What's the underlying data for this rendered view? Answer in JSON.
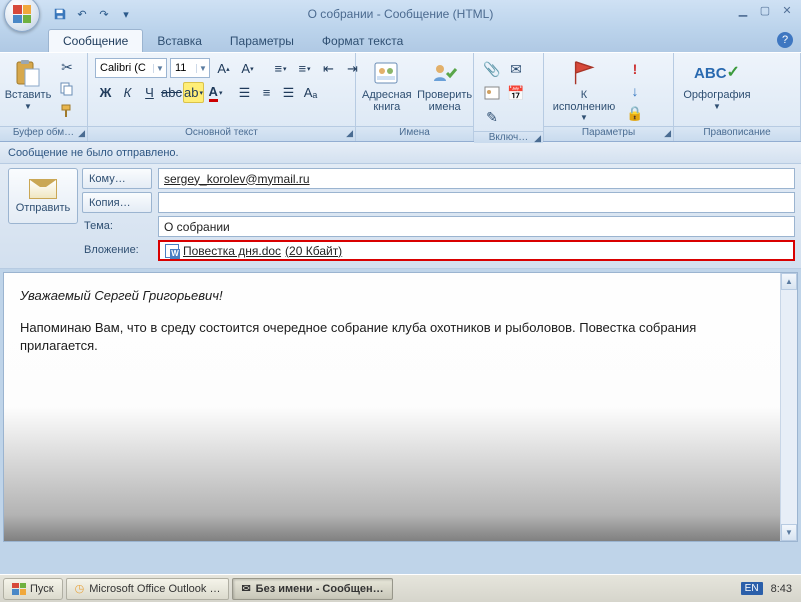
{
  "window_title": "О собрании - Сообщение (HTML)",
  "qat_dropdown": "▾",
  "tabs": {
    "t1": "Сообщение",
    "t2": "Вставка",
    "t3": "Параметры",
    "t4": "Формат текста"
  },
  "ribbon": {
    "clipboard": {
      "paste": "Вставить",
      "label": "Буфер обм…"
    },
    "font": {
      "name": "Calibri (С",
      "size": "11",
      "label": "Основной текст"
    },
    "names": {
      "addressbook": "Адресная\nкнига",
      "checknames": "Проверить\nимена",
      "label": "Имена"
    },
    "include": {
      "label": "Включ…"
    },
    "followup": {
      "flag": "К\nисполнению",
      "label": "Параметры"
    },
    "proofing": {
      "spell": "Орфография",
      "label": "Правописание"
    }
  },
  "infobar": "Сообщение не было отправлено.",
  "header": {
    "send": "Отправить",
    "to_btn": "Кому…",
    "cc_btn": "Копия…",
    "subject_lbl": "Тема:",
    "attach_lbl": "Вложение:",
    "to_value": "sergey_korolev@mymail.ru",
    "cc_value": "",
    "subject_value": "О собрании",
    "attachment_name": "Повестка дня.doc",
    "attachment_size": "(20 Кбайт)"
  },
  "body": {
    "greeting": "Уважаемый Сергей Григорьевич!",
    "p1": "Напоминаю Вам, что в среду состоится очередное собрание клуба охотников и рыболовов. Повестка собрания прилагается."
  },
  "taskbar": {
    "start": "Пуск",
    "item1": "Microsoft Office Outlook …",
    "item2": "Без имени - Сообщен…",
    "lang": "EN",
    "clock": "8:43"
  }
}
